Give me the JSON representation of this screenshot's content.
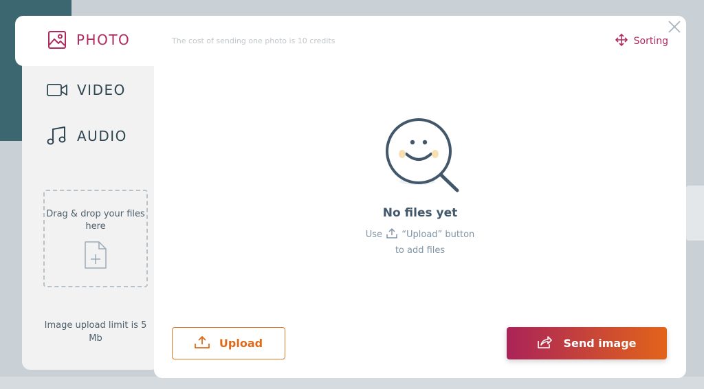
{
  "colors": {
    "accent": "#b0295c",
    "orange": "#e06a1a",
    "text_dark": "#2f4650",
    "muted": "#7f94a6"
  },
  "tabs": [
    {
      "label": "PHOTO",
      "icon": "image-icon",
      "active": true
    },
    {
      "label": "VIDEO",
      "icon": "video-camera-icon",
      "active": false
    },
    {
      "label": "AUDIO",
      "icon": "music-note-icon",
      "active": false
    }
  ],
  "dropzone": {
    "text": "Drag & drop your files here",
    "icon": "file-add-icon"
  },
  "limit_text": "Image upload limit is 5 Mb",
  "header": {
    "cost_text": "The cost of sending one photo is 10 credits",
    "sorting_label": "Sorting",
    "sorting_icon": "move-arrows-icon",
    "close_icon": "close-icon"
  },
  "empty_state": {
    "icon": "smiley-magnifier-icon",
    "title": "No files yet",
    "hint_before": "Use",
    "hint_after": "“Upload” button",
    "hint_line2": "to add files"
  },
  "buttons": {
    "upload_label": "Upload",
    "upload_icon": "upload-tray-icon",
    "send_label": "Send image",
    "send_icon": "share-icon"
  }
}
